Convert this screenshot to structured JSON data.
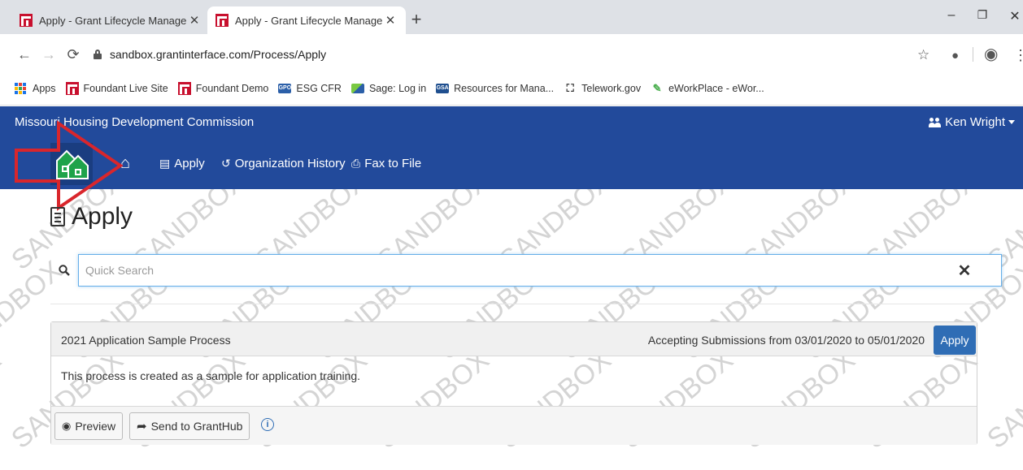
{
  "browser": {
    "tabs": [
      {
        "title": "Apply - Grant Lifecycle Manager",
        "active": false
      },
      {
        "title": "Apply - Grant Lifecycle Manager",
        "active": true
      }
    ],
    "url": "sandbox.grantinterface.com/Process/Apply",
    "bookmarks": [
      {
        "label": "Apps",
        "icon": "apps-grid-icon"
      },
      {
        "label": "Foundant Live Site",
        "icon": "foundant-icon"
      },
      {
        "label": "Foundant Demo",
        "icon": "foundant-icon"
      },
      {
        "label": "ESG CFR",
        "icon": "gpo-icon"
      },
      {
        "label": "Sage: Log in",
        "icon": "sage-icon"
      },
      {
        "label": "Resources for Mana...",
        "icon": "gsa-icon"
      },
      {
        "label": "Telework.gov",
        "icon": "telework-icon"
      },
      {
        "label": "eWorkPlace - eWor...",
        "icon": "eworkplace-icon"
      }
    ]
  },
  "site": {
    "org_name": "Missouri Housing Development Commission",
    "user_name": "Ken Wright",
    "nav": [
      {
        "label": "Apply",
        "icon": "document-icon"
      },
      {
        "label": "Organization History",
        "icon": "history-icon"
      },
      {
        "label": "Fax to File",
        "icon": "fax-icon"
      }
    ],
    "colors": {
      "header": "#224a9b",
      "button": "#2f6db5",
      "annotation_arrow": "#d9262c"
    }
  },
  "page": {
    "title": "Apply",
    "search_placeholder": "Quick Search",
    "watermark": "SANDBOX"
  },
  "process": {
    "title": "2021 Application Sample Process",
    "dates": "Accepting Submissions from 03/01/2020 to 05/01/2020",
    "apply_label": "Apply",
    "description": "This process is created as a sample for application training.",
    "preview_label": "Preview",
    "send_label": "Send to GrantHub"
  }
}
